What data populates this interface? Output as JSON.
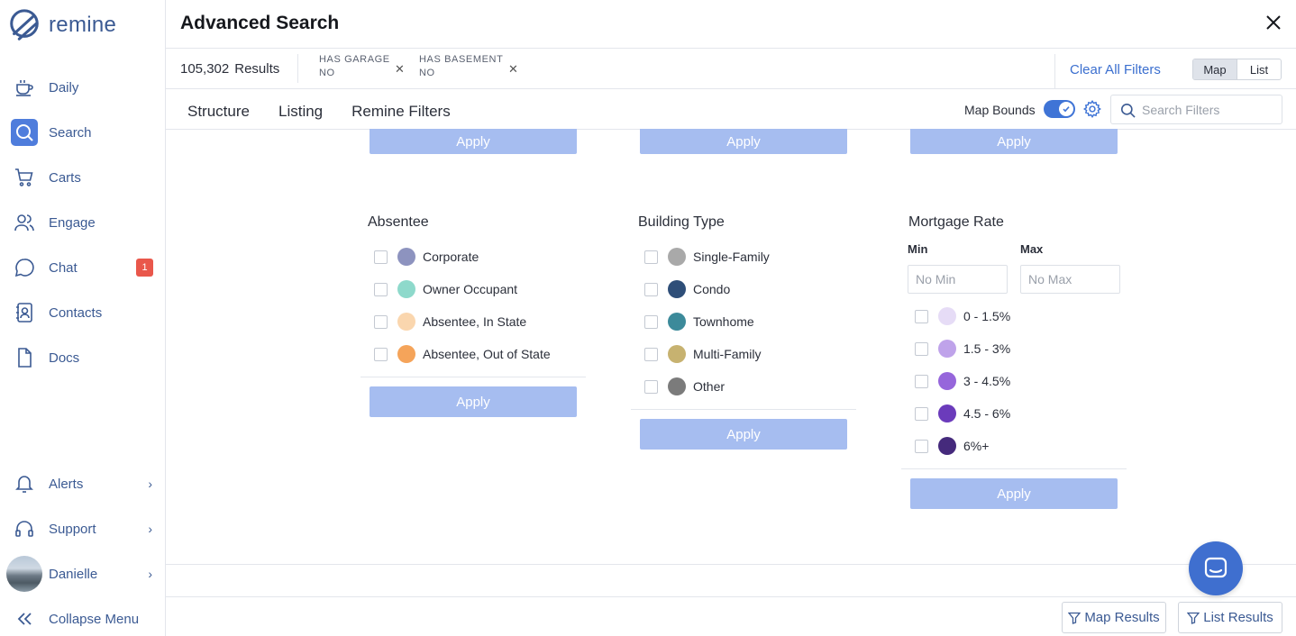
{
  "brand": {
    "name": "remine",
    "color": "#3b5a93",
    "accent": "#4f7ddc"
  },
  "sidebar": {
    "items": [
      {
        "key": "daily",
        "label": "Daily",
        "icon": "cup-icon"
      },
      {
        "key": "search",
        "label": "Search",
        "icon": "search-icon",
        "active": true
      },
      {
        "key": "carts",
        "label": "Carts",
        "icon": "cart-icon"
      },
      {
        "key": "engage",
        "label": "Engage",
        "icon": "users-icon"
      },
      {
        "key": "chat",
        "label": "Chat",
        "icon": "chat-icon",
        "badge": "1"
      },
      {
        "key": "contacts",
        "label": "Contacts",
        "icon": "contacts-icon"
      },
      {
        "key": "docs",
        "label": "Docs",
        "icon": "document-icon"
      }
    ],
    "bottom": [
      {
        "key": "alerts",
        "label": "Alerts",
        "icon": "bell-icon"
      },
      {
        "key": "support",
        "label": "Support",
        "icon": "headset-icon"
      },
      {
        "key": "user",
        "label": "Danielle",
        "icon": "avatar"
      }
    ],
    "collapse_label": "Collapse Menu"
  },
  "header": {
    "title": "Advanced Search",
    "results_count": "105,302",
    "results_label": "Results",
    "chips": [
      {
        "key": "HAS GARAGE",
        "value": "NO"
      },
      {
        "key": "HAS BASEMENT",
        "value": "NO"
      }
    ],
    "clear_all": "Clear All Filters",
    "view_toggle": {
      "map": "Map",
      "list": "List",
      "selected": "Map"
    }
  },
  "tabs": [
    "Structure",
    "Listing",
    "Remine Filters"
  ],
  "toolbar": {
    "map_bounds_label": "Map Bounds",
    "map_bounds_on": true,
    "search_placeholder": "Search Filters"
  },
  "apply_label": "Apply",
  "filters": {
    "absentee": {
      "title": "Absentee",
      "options": [
        {
          "label": "Corporate",
          "color": "#8d93bf"
        },
        {
          "label": "Owner Occupant",
          "color": "#8ed9cb"
        },
        {
          "label": "Absentee, In State",
          "color": "#fad6ae"
        },
        {
          "label": "Absentee, Out of State",
          "color": "#f5a45a"
        }
      ]
    },
    "building_type": {
      "title": "Building Type",
      "options": [
        {
          "label": "Single-Family",
          "color": "#a9a9a9"
        },
        {
          "label": "Condo",
          "color": "#2e4e78"
        },
        {
          "label": "Townhome",
          "color": "#3c8a9a"
        },
        {
          "label": "Multi-Family",
          "color": "#c7b270"
        },
        {
          "label": "Other",
          "color": "#7b7b7b"
        }
      ]
    },
    "mortgage_rate": {
      "title": "Mortgage Rate",
      "min_label": "Min",
      "max_label": "Max",
      "min_placeholder": "No Min",
      "max_placeholder": "No Max",
      "options": [
        {
          "label": "0 - 1.5%",
          "color": "#e6dcf6"
        },
        {
          "label": "1.5 - 3%",
          "color": "#bfa3ea"
        },
        {
          "label": "3 - 4.5%",
          "color": "#9666db"
        },
        {
          "label": "4.5 - 6%",
          "color": "#6b3bbb"
        },
        {
          "label": "6%+",
          "color": "#452a7c"
        }
      ]
    }
  },
  "footer": {
    "map_results": "Map Results",
    "list_results": "List Results"
  }
}
